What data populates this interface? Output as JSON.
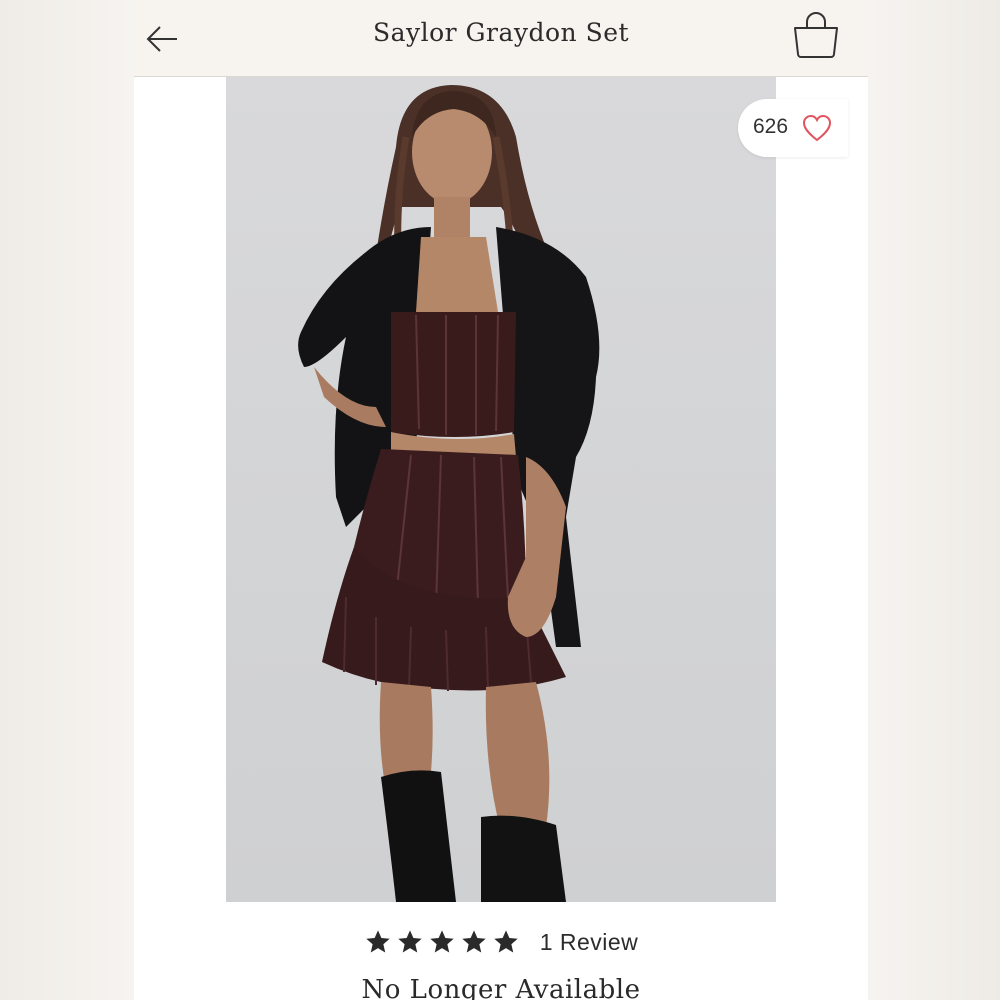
{
  "header": {
    "title": "Saylor Graydon Set",
    "back_icon": "arrow-left-icon",
    "bag_icon": "shopping-bag-icon"
  },
  "product": {
    "favorite_count": "626",
    "favorite_icon": "heart-outline-icon",
    "image_description": "product-photo",
    "rating": {
      "stars": 5,
      "max_stars": 5,
      "review_label": "1 Review"
    },
    "availability": "No Longer Available"
  },
  "colors": {
    "header_bg": "#f7f3ef",
    "heart": "#e0555f",
    "text": "#2b2b2b",
    "photo_bg": "#d5d6d8"
  }
}
